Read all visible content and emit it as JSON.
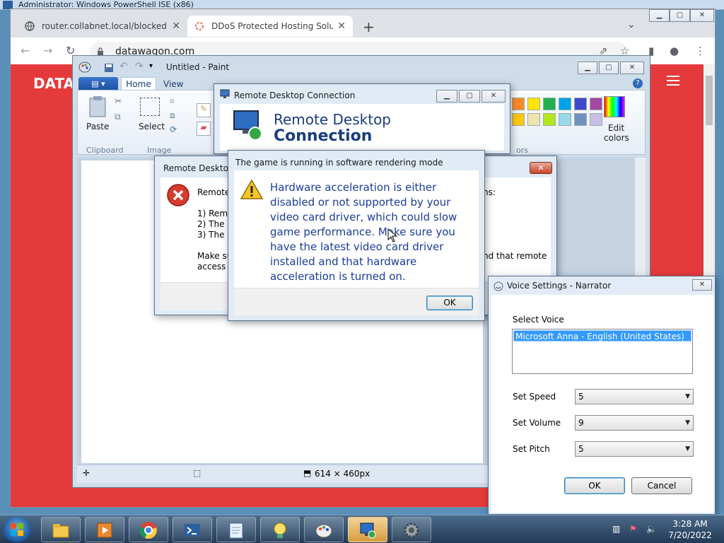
{
  "ise": {
    "title": "Administrator: Windows PowerShell ISE (x86)"
  },
  "chrome": {
    "tabs": [
      {
        "title": "router.collabnet.local/blocked.ph"
      },
      {
        "title": "DDoS Protected Hosting Solution"
      }
    ],
    "address": "datawagon.com",
    "page_logo": "DATA",
    "window_controls": {
      "minimize": "▁",
      "maximize": "▢",
      "close": "✕"
    }
  },
  "paint": {
    "title": "Untitled - Paint",
    "tabs": {
      "home": "Home",
      "view": "View"
    },
    "groups": {
      "clipboard": "Clipboard",
      "image": "Image",
      "colors": "ors"
    },
    "buttons": {
      "paste": "Paste",
      "select": "Select",
      "edit_colors_1": "Edit",
      "edit_colors_2": "colors"
    },
    "status": {
      "dimensions": "614 × 460px"
    },
    "colors": [
      "#ff8a2a",
      "#ffe600",
      "#22b14c",
      "#00a2e8",
      "#3f48cc",
      "#a349a4",
      "#ffc90e",
      "#efe4b0",
      "#b5e61d",
      "#99d9ea",
      "#7092be",
      "#c8bfe7"
    ]
  },
  "rdc_back": {
    "title": "Remote Desktop Connection",
    "heading_line1": "Remote Desktop",
    "heading_line2": "Connection"
  },
  "rdc_error": {
    "title": "Remote Desktop",
    "line_intro_start": "Remote",
    "line_intro_end": "ns:",
    "item1": "1) Remo",
    "item2": "2) The re",
    "item3": "3) The re",
    "note_start": "Make su",
    "note_end": "nd that remote",
    "note_line2": "access is"
  },
  "game_dialog": {
    "title": "The game is running in software rendering mode",
    "message": "Hardware acceleration is either disabled or not supported by your video card driver, which could slow game performance. Make sure you have the latest video card driver installed and that hardware acceleration is turned on.",
    "ok": "OK"
  },
  "narrator": {
    "title": "Voice Settings - Narrator",
    "select_voice_label": "Select Voice",
    "voices": [
      "Microsoft Anna - English (United States)"
    ],
    "speed_label": "Set Speed",
    "speed": "5",
    "volume_label": "Set Volume",
    "volume": "9",
    "pitch_label": "Set Pitch",
    "pitch": "5",
    "ok": "OK",
    "cancel": "Cancel"
  },
  "taskbar": {
    "time": "3:28 AM",
    "date": "7/20/2022"
  }
}
